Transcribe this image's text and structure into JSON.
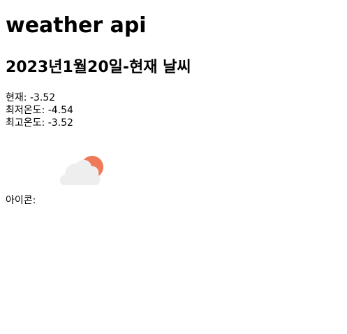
{
  "page": {
    "title": "weather api",
    "subtitle": "2023년1월20일-현재 날씨"
  },
  "readings": {
    "current_label": "현재: ",
    "current_value": "-3.52",
    "min_label": "최저온도: ",
    "min_value": "-4.54",
    "max_label": "최고온도: ",
    "max_value": "-3.52"
  },
  "icon": {
    "label": "아이콘:",
    "name": "partly-cloudy-icon",
    "sun_color": "#ef7a5a",
    "cloud_color": "#eeeeee"
  }
}
